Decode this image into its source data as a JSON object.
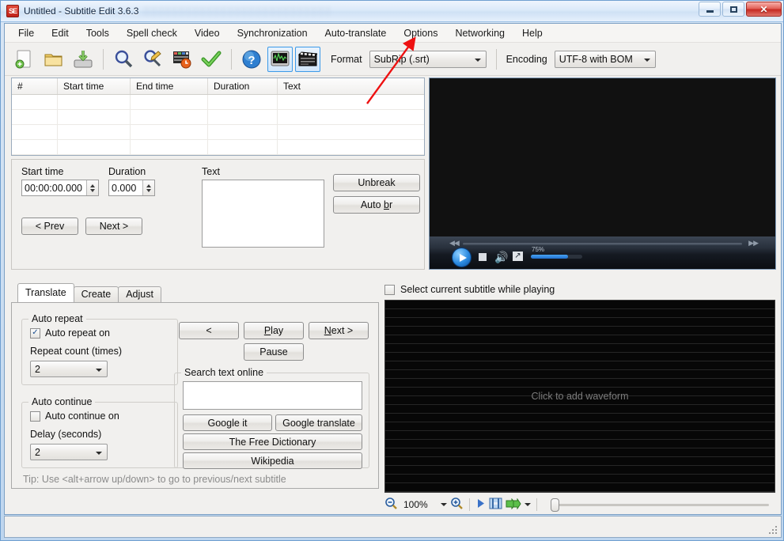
{
  "window": {
    "title": "Untitled - Subtitle Edit 3.6.3",
    "icon": "subtitle-edit-icon",
    "ghost_text": "░░░░░░░░░░░░░░░░░░░░░░░░░░░",
    "minimize": "—",
    "maximize": "□",
    "close": "✕"
  },
  "menubar": {
    "items": [
      {
        "label": "File"
      },
      {
        "label": "Edit"
      },
      {
        "label": "Tools"
      },
      {
        "label": "Spell check"
      },
      {
        "label": "Video"
      },
      {
        "label": "Synchronization"
      },
      {
        "label": "Auto-translate"
      },
      {
        "label": "Options"
      },
      {
        "label": "Networking"
      },
      {
        "label": "Help"
      }
    ]
  },
  "toolbar": {
    "buttons": [
      {
        "name": "new-subtitle-icon"
      },
      {
        "name": "open-subtitle-icon"
      },
      {
        "name": "save-subtitle-icon"
      },
      {
        "name": "find-icon"
      },
      {
        "name": "replace-icon"
      },
      {
        "name": "visual-sync-icon"
      },
      {
        "name": "spell-check-icon"
      },
      {
        "name": "help-icon"
      }
    ],
    "toggle_waveform": "waveform-toggle-icon",
    "toggle_video": "video-toggle-icon",
    "format_label": "Format",
    "format_value": "SubRip (.srt)",
    "encoding_label": "Encoding",
    "encoding_value": "UTF-8 with BOM"
  },
  "subtitle_list": {
    "columns": [
      "#",
      "Start time",
      "End time",
      "Duration",
      "Text"
    ],
    "rows": []
  },
  "editor": {
    "start_time_label": "Start time",
    "start_time_value": "00:00:00.000",
    "duration_label": "Duration",
    "duration_value": "0.000",
    "text_label": "Text",
    "text_value": "",
    "prev_button": "< Prev",
    "next_button": "Next >",
    "unbreak_button": "Unbreak",
    "autobr_button": "Auto br"
  },
  "video_player": {
    "play": "play-button",
    "stop": "stop-button",
    "volume": "volume-icon",
    "fullscreen": "fullscreen-icon",
    "volume_percent": "75%",
    "rewind": "◀◀",
    "fastforward": "▶▶"
  },
  "tabs": {
    "items": [
      {
        "label": "Translate",
        "active": true
      },
      {
        "label": "Create",
        "active": false
      },
      {
        "label": "Adjust",
        "active": false
      }
    ]
  },
  "translate_tab": {
    "auto_repeat": {
      "group_title": "Auto repeat",
      "checkbox_label": "Auto repeat on",
      "checkbox_checked": true,
      "count_label": "Repeat count (times)",
      "count_value": "2"
    },
    "auto_continue": {
      "group_title": "Auto continue",
      "checkbox_label": "Auto continue on",
      "checkbox_checked": false,
      "delay_label": "Delay (seconds)",
      "delay_value": "2"
    },
    "playback": {
      "prev_button": "<",
      "play_button": "Play",
      "next_button": "Next >",
      "pause_button": "Pause"
    },
    "search_online": {
      "group_title": "Search text online",
      "input_value": "",
      "google_it": "Google it",
      "google_translate": "Google translate",
      "free_dictionary": "The Free Dictionary",
      "wikipedia": "Wikipedia"
    },
    "tip": "Tip: Use <alt+arrow up/down> to go to previous/next subtitle"
  },
  "waveform": {
    "select_while_playing_label": "Select current subtitle while playing",
    "select_while_playing_checked": false,
    "placeholder": "Click to add waveform",
    "zoom_out_icon": "zoom-out-icon",
    "zoom_value": "100%",
    "zoom_in_icon": "zoom-in-icon",
    "play_icon": "play-icon",
    "shot_changes_icon": "shot-changes-icon",
    "seek_silence_icon": "seek-silence-icon"
  },
  "statusbar": {
    "text": ""
  },
  "annotation": {
    "color": "#ee1111",
    "target": "Options"
  }
}
